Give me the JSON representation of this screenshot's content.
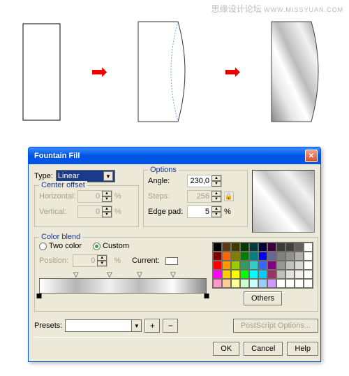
{
  "watermark": {
    "text": "思缘设计论坛",
    "url": "WWW.MISSYUAN.COM"
  },
  "dialog": {
    "title": "Fountain Fill",
    "type_label": "Type:",
    "type_value": "Linear",
    "center_offset": {
      "legend": "Center offset",
      "horizontal_label": "Horizontal:",
      "horizontal_value": "0",
      "vertical_label": "Vertical:",
      "vertical_value": "0"
    },
    "options": {
      "legend": "Options",
      "angle_label": "Angle:",
      "angle_value": "230,0",
      "steps_label": "Steps:",
      "steps_value": "256",
      "edgepad_label": "Edge pad:",
      "edgepad_value": "5"
    },
    "color_blend": {
      "legend": "Color blend",
      "two_color_label": "Two color",
      "custom_label": "Custom",
      "position_label": "Position:",
      "position_value": "0",
      "current_label": "Current:",
      "others_label": "Others"
    },
    "presets_label": "Presets:",
    "postscript_label": "PostScript Options...",
    "buttons": {
      "ok": "OK",
      "cancel": "Cancel",
      "help": "Help"
    }
  },
  "percent": "%",
  "palette": [
    "#000000",
    "#5b3a1a",
    "#3b3b00",
    "#003b00",
    "#003b3b",
    "#00003b",
    "#3b003b",
    "#3b3b3b",
    "#404040",
    "#606060",
    "#ffffff",
    "#800000",
    "#ff6600",
    "#808000",
    "#008000",
    "#008080",
    "#0000ff",
    "#666699",
    "#808080",
    "#909090",
    "#b0b0b0",
    "#ffffff",
    "#ff0000",
    "#ff9900",
    "#99cc00",
    "#339966",
    "#33cccc",
    "#3366ff",
    "#800080",
    "#969696",
    "#c0c0c0",
    "#d8d8d8",
    "#ffffff",
    "#ff00ff",
    "#ffcc00",
    "#ffff00",
    "#00ff00",
    "#00ffff",
    "#00ccff",
    "#993366",
    "#c0c0c0",
    "#e0e0e0",
    "#f0f0f0",
    "#ffffff",
    "#ff99cc",
    "#ffcc99",
    "#ffff99",
    "#ccffcc",
    "#ccffff",
    "#99ccff",
    "#cc99ff",
    "#ffffff",
    "#ffffff",
    "#ffffff",
    "#ffffff"
  ]
}
